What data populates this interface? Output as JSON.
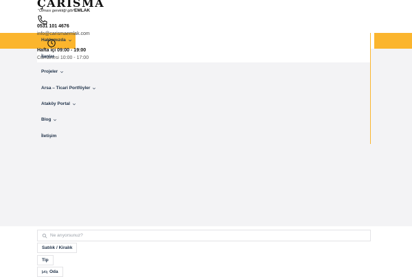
{
  "logo": {
    "wordmark": "ÇARİSMA",
    "tagline": "\"Olması gerektiği gibi\"",
    "suffix": "EMLAK"
  },
  "contact": {
    "phone": "0531 101 4676",
    "email": "info@carismaemlak.com",
    "hours_weekday": "Hafta içi 09:00 - 19:00",
    "hours_sunday": "Cumartesi 10:00 - 17:00"
  },
  "nav": {
    "items": [
      {
        "label": "Hakkımızda",
        "has_dropdown": true
      },
      {
        "label": "İlanlar",
        "has_dropdown": false
      },
      {
        "label": "Projeler",
        "has_dropdown": true
      },
      {
        "label": "Arsa – Ticari Portföyler",
        "has_dropdown": true
      },
      {
        "label": "Ataköy Portal",
        "has_dropdown": true
      },
      {
        "label": "Blog",
        "has_dropdown": true
      },
      {
        "label": "İletişim",
        "has_dropdown": false
      }
    ]
  },
  "search": {
    "placeholder": "Ne arıyorsunuz?",
    "value": ""
  },
  "filters": {
    "type": "Satılık / Kiralık",
    "kind": "Tip",
    "rooms": "Oda"
  },
  "colors": {
    "accent": "#fbb52d",
    "hero_bg": "#f3f3f5",
    "nav_text": "#22344b"
  }
}
